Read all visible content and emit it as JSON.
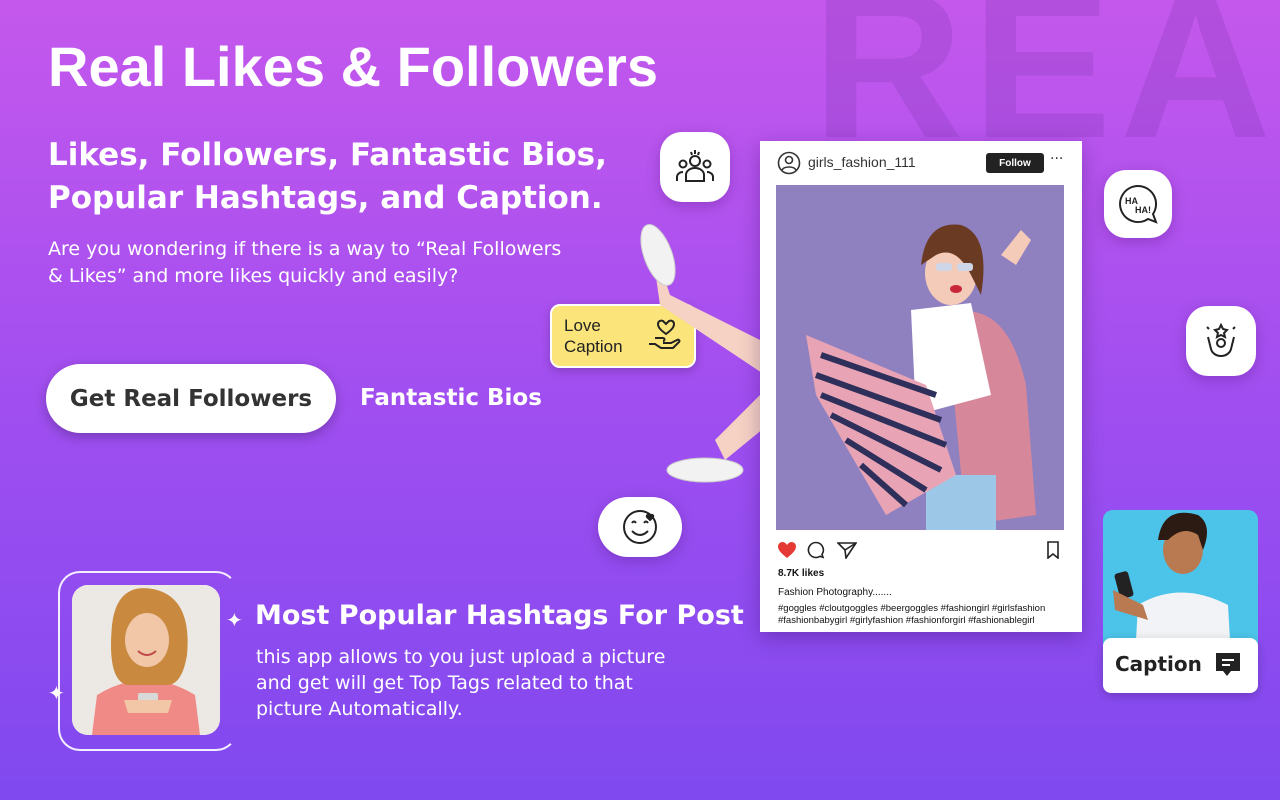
{
  "background_word": "REAL",
  "hero": {
    "title": "Real Likes & Followers",
    "subtitle": "Likes, Followers, Fantastic Bios, Popular Hashtags, and Caption.",
    "description": "Are you wondering if there is a way to “Real Followers & Likes” and more likes quickly and easily?",
    "primary_button": "Get Real Followers",
    "secondary_link": "Fantastic Bios"
  },
  "feature": {
    "title": "Most Popular Hashtags For Post",
    "description": "this app allows to you just upload a picture and get will get Top Tags related to that picture Automatically."
  },
  "love_card": {
    "label": "Love Caption"
  },
  "post": {
    "username": "girls_fashion_111",
    "follow_label": "Follow",
    "more_label": "···",
    "likes": "8.7K likes",
    "caption": "Fashion Photography.......",
    "hashtags": "#goggles #cloutgoggles #beergoggles #fashiongirl #girlsfashion #fashionbabygirl #girlyfashion #fashionforgirl #fashionablegirl"
  },
  "caption_card": {
    "label": "Caption"
  },
  "icons": [
    "users-group-icon",
    "haha-chat-icon",
    "star-person-icon",
    "happy-face-icon",
    "heart-hand-icon",
    "chat-bubble-icon"
  ],
  "colors": {
    "accent_yellow": "#fbe57a",
    "heart_red": "#e53935",
    "bg_top": "#c558ec",
    "bg_bottom": "#7f49ef"
  }
}
